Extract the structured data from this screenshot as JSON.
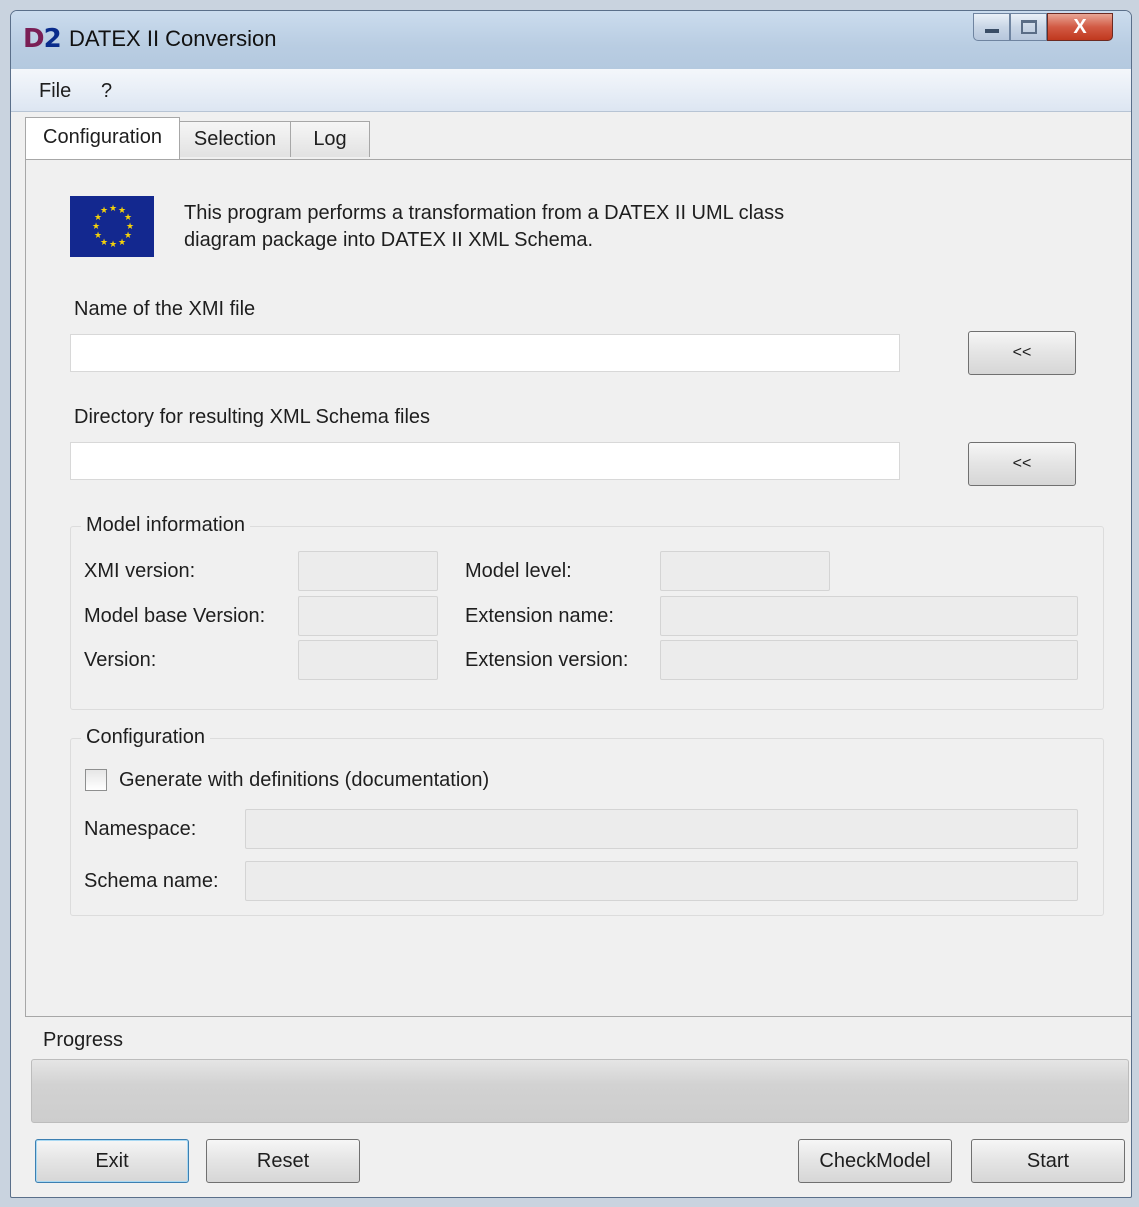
{
  "window": {
    "app_logo": "D2",
    "title": "DATEX II Conversion",
    "close_glyph": "X"
  },
  "menu": [
    {
      "label": "File"
    },
    {
      "label": "?"
    }
  ],
  "tabs": [
    {
      "label": "Configuration",
      "active": true
    },
    {
      "label": "Selection",
      "active": false
    },
    {
      "label": "Log",
      "active": false
    }
  ],
  "intro": {
    "line1": "This program performs a transformation from a DATEX II UML class",
    "line2": "diagram package into DATEX II XML Schema."
  },
  "xmi_file": {
    "label": "Name of the XMI file",
    "value": "",
    "browse_label": "<<"
  },
  "output_dir": {
    "label": "Directory for resulting XML Schema files",
    "value": "",
    "browse_label": "<<"
  },
  "model_info": {
    "legend": "Model information",
    "xmi_version_label": "XMI version:",
    "model_base_version_label": "Model base Version:",
    "version_label": "Version:",
    "model_level_label": "Model level:",
    "extension_name_label": "Extension name:",
    "extension_version_label": "Extension version:"
  },
  "configuration": {
    "legend": "Configuration",
    "generate_definitions_label": "Generate with definitions (documentation)",
    "generate_definitions_checked": false,
    "namespace_label": "Namespace:",
    "schema_name_label": "Schema name:"
  },
  "progress": {
    "label": "Progress",
    "percent": 0
  },
  "buttons": {
    "exit": "Exit",
    "reset": "Reset",
    "check_model": "CheckModel",
    "start": "Start"
  }
}
